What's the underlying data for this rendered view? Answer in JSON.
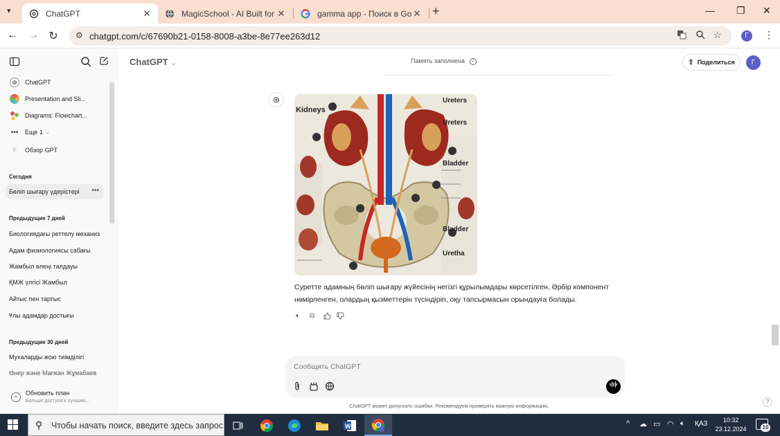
{
  "browser": {
    "tabs": [
      {
        "title": "ChatGPT",
        "favicon": "openai-icon",
        "active": true
      },
      {
        "title": "MagicSchool - AI Built for Scho",
        "favicon": "globe-icon",
        "active": false
      },
      {
        "title": "gamma app - Поиск в Google",
        "favicon": "google-icon",
        "active": false
      }
    ],
    "url": "chatgpt.com/c/67690b21-0158-8008-a3be-8e77ee263d12",
    "profile_initial": "Г",
    "tab_close": "✕",
    "new_tab": "+"
  },
  "sidebar": {
    "gpts": [
      {
        "label": "ChatGPT",
        "icon": "openai-icon"
      },
      {
        "label": "Presentation and Sli...",
        "icon": "presentation-gpt-icon"
      },
      {
        "label": "Diagrams: Flowchart...",
        "icon": "diagrams-gpt-icon"
      },
      {
        "label": "Еще 1",
        "icon": "more-icon"
      },
      {
        "label": "Обзор GPT",
        "icon": "grid-icon"
      }
    ],
    "sections": [
      {
        "title": "Сегодня",
        "chats": [
          "Бөліп шығару үдерістері"
        ]
      },
      {
        "title": "Предыдущие 7 дней",
        "chats": [
          "Биологиядағы реттелу механиз",
          "Адам физиологиясы сабағы",
          "Жамбыл өлеңі талдауы",
          "ҚМЖ үлгісі Жамбыл",
          "Айтыс пен тартыс",
          "Ұлы адамдар достығы"
        ]
      },
      {
        "title": "Предыдущие 30 дней",
        "chats": [
          "Мухаларды жою тиімділігі",
          "Өнер және Мағжан Жұмабаев"
        ]
      }
    ],
    "upgrade": {
      "title": "Обновить план",
      "subtitle": "Больше доступа к лучшим..."
    }
  },
  "main": {
    "model": "ChatGPT",
    "memory_status": "Память заполнена",
    "share_label": "Поделиться",
    "user_initial": "Г",
    "image_labels": {
      "kidneys": "Kidneys",
      "ureters_1": "Ureters",
      "ureters_2": "Ureters",
      "bladder_1": "Bladder",
      "bladder_2": "Bladder",
      "urethra": "Uretha"
    },
    "answer": "Суретте адамның бөліп шығару жүйесінің негізгі құрылымдары көрсетілген. Әрбір компонент нөмірленген, олардың қызметтерін түсіндіріп, оқу тапсырмасын орындауға болады.",
    "composer_placeholder": "Сообщить ChatGPT",
    "disclaimer": "ChatGPT может допускать ошибки. Рекомендуем проверять важную информацию.",
    "help": "?"
  },
  "taskbar": {
    "search_placeholder": "Чтобы начать поиск, введите здесь запрос",
    "apps": [
      "task-view-icon",
      "chrome-icon",
      "edge-icon",
      "file-explorer-icon",
      "word-icon",
      "chrome-profile-icon"
    ],
    "language": "ҚАЗ",
    "time": "10:32",
    "date": "23.12.2024",
    "notifications": "10"
  }
}
